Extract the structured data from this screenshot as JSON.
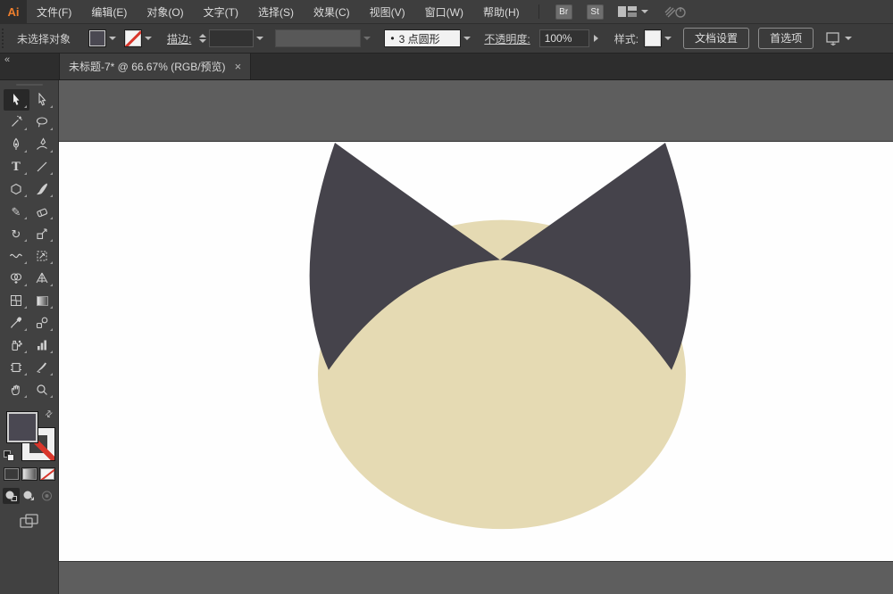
{
  "menu_bar": {
    "logo": "Ai",
    "items": [
      {
        "label": "文件(F)"
      },
      {
        "label": "编辑(E)"
      },
      {
        "label": "对象(O)"
      },
      {
        "label": "文字(T)"
      },
      {
        "label": "选择(S)"
      },
      {
        "label": "效果(C)"
      },
      {
        "label": "视图(V)"
      },
      {
        "label": "窗口(W)"
      },
      {
        "label": "帮助(H)"
      }
    ],
    "bridge_badge": "Br",
    "stock_badge": "St"
  },
  "control_bar": {
    "status_label": "未选择对象",
    "stroke_label": "描边:",
    "brush_preview_glyph": "•",
    "brush_preset": "3 点圆形",
    "opacity_label": "不透明度:",
    "opacity_value": "100%",
    "style_label": "样式:",
    "document_setup_button": "文档设置",
    "preferences_button": "首选项"
  },
  "tab_bar": {
    "collapse_glyph": "«",
    "active_tab": {
      "title": "未标题-7* @ 66.67% (RGB/预览)",
      "close_glyph": "×"
    }
  },
  "toolbar": {
    "tools": [
      "selection",
      "direct-selection",
      "magic-wand",
      "lasso",
      "pen",
      "curvature",
      "type",
      "line-segment",
      "polygon",
      "paintbrush",
      "pencil",
      "eraser",
      "rotate",
      "scale",
      "width",
      "free-transform",
      "shape-builder",
      "perspective-grid",
      "mesh",
      "gradient",
      "eyedropper",
      "blend",
      "symbol-sprayer",
      "column-graph",
      "artboard",
      "slice",
      "hand",
      "zoom"
    ],
    "active_tool": "selection",
    "current_fill_color": "#4a4852",
    "current_stroke": "none"
  },
  "icons": {
    "type_tool_glyph": "T",
    "pencil_tool_glyph": "✎",
    "rotate_tool_glyph": "↻",
    "swap_fill_stroke_glyph": "⇄",
    "workspace_switcher": "window-grid",
    "cs_live": "signal-power",
    "arrange_documents": "document-arrange"
  },
  "canvas": {
    "pasteboard_color": "#5e5e5e",
    "artboard_color": "#fefefe",
    "artwork": {
      "description": "cat head: cream ellipse with two dark curved triangular ears",
      "head_fill": "#e5dab3",
      "ear_fill": "#45434b"
    }
  }
}
